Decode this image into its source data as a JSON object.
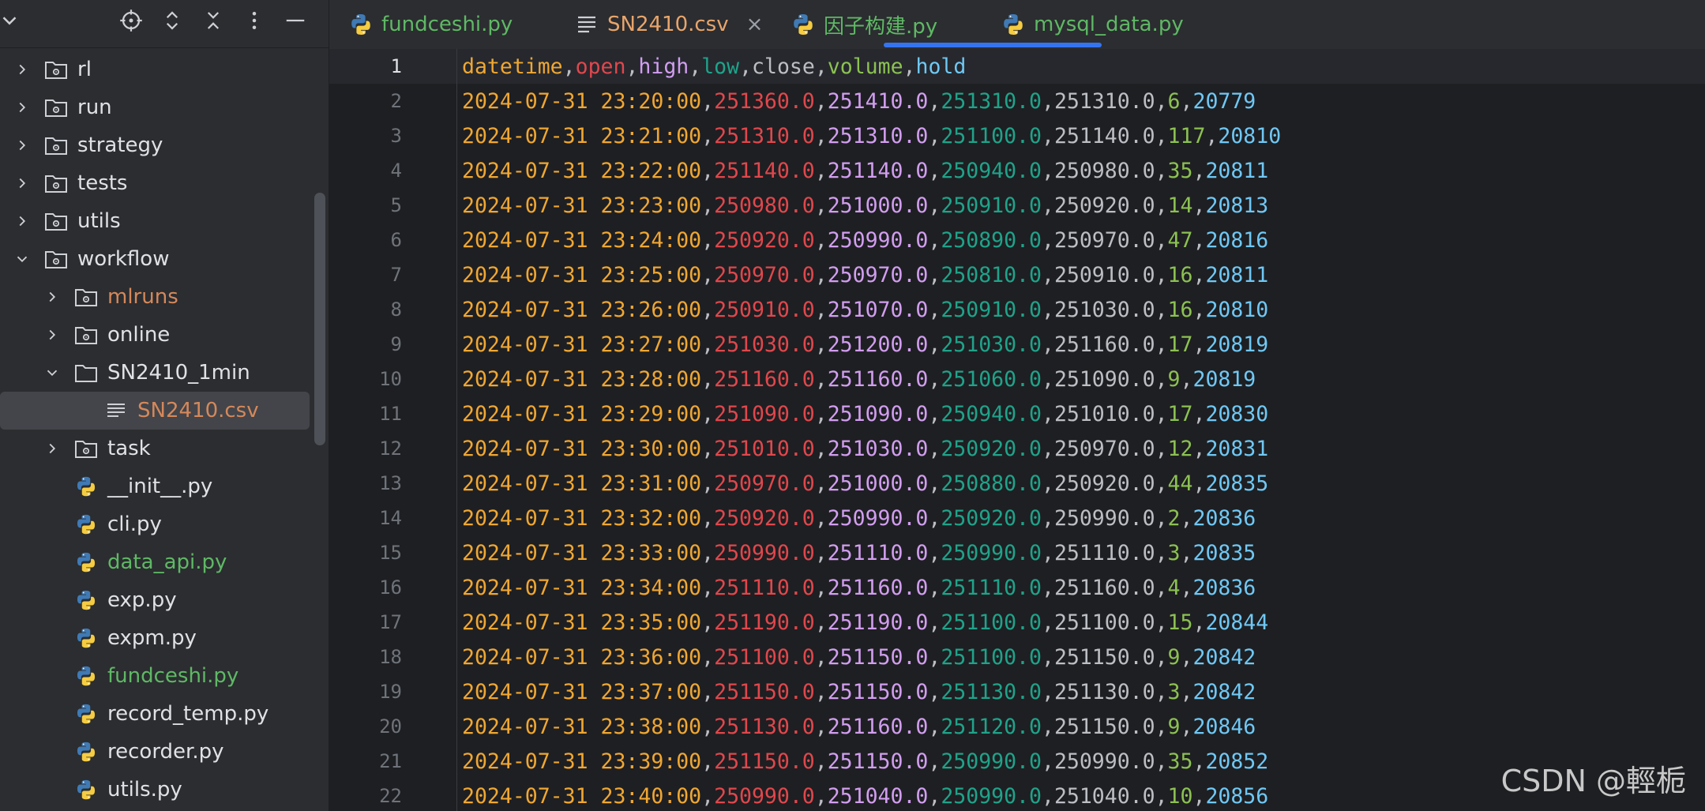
{
  "sidebar": {
    "toolbar": [
      "locate-icon",
      "expand-all-icon",
      "collapse-all-icon",
      "more-options-icon",
      "hide-icon"
    ],
    "items": [
      {
        "label": "rl",
        "type": "folder",
        "indent": 0,
        "expanded": false
      },
      {
        "label": "run",
        "type": "folder",
        "indent": 0,
        "expanded": false
      },
      {
        "label": "strategy",
        "type": "folder",
        "indent": 0,
        "expanded": false
      },
      {
        "label": "tests",
        "type": "folder",
        "indent": 0,
        "expanded": false
      },
      {
        "label": "utils",
        "type": "folder",
        "indent": 0,
        "expanded": false
      },
      {
        "label": "workflow",
        "type": "folder",
        "indent": 0,
        "expanded": true
      },
      {
        "label": "mlruns",
        "type": "folder",
        "indent": 1,
        "expanded": false,
        "color": "orange"
      },
      {
        "label": "online",
        "type": "folder",
        "indent": 1,
        "expanded": false
      },
      {
        "label": "SN2410_1min",
        "type": "plainfolder",
        "indent": 1,
        "expanded": true
      },
      {
        "label": "SN2410.csv",
        "type": "text",
        "indent": 2,
        "selected": true,
        "color": "orange"
      },
      {
        "label": "task",
        "type": "folder",
        "indent": 1,
        "expanded": false
      },
      {
        "label": "__init__.py",
        "type": "python",
        "indent": 1
      },
      {
        "label": "cli.py",
        "type": "python",
        "indent": 1
      },
      {
        "label": "data_api.py",
        "type": "python",
        "indent": 1,
        "color": "green"
      },
      {
        "label": "exp.py",
        "type": "python",
        "indent": 1
      },
      {
        "label": "expm.py",
        "type": "python",
        "indent": 1
      },
      {
        "label": "fundceshi.py",
        "type": "python",
        "indent": 1,
        "color": "green"
      },
      {
        "label": "record_temp.py",
        "type": "python",
        "indent": 1
      },
      {
        "label": "recorder.py",
        "type": "python",
        "indent": 1
      },
      {
        "label": "utils.py",
        "type": "python",
        "indent": 1
      }
    ]
  },
  "tabs": [
    {
      "label": "fundceshi.py",
      "icon": "python-icon",
      "color": "green"
    },
    {
      "label": "SN2410.csv",
      "icon": "text-file-icon",
      "color": "orange",
      "active": true,
      "close": "×"
    },
    {
      "label": "因子构建.py",
      "icon": "python-icon",
      "color": "green"
    },
    {
      "label": "mysql_data.py",
      "icon": "python-icon",
      "color": "green"
    }
  ],
  "editor": {
    "header": [
      "datetime",
      "open",
      "high",
      "low",
      "close",
      "volume",
      "hold"
    ],
    "start_line": 1,
    "rows": [
      [
        "2024-07-31 23:20:00",
        "251360.0",
        "251410.0",
        "251310.0",
        "251310.0",
        "6",
        "20779"
      ],
      [
        "2024-07-31 23:21:00",
        "251310.0",
        "251310.0",
        "251100.0",
        "251140.0",
        "117",
        "20810"
      ],
      [
        "2024-07-31 23:22:00",
        "251140.0",
        "251140.0",
        "250940.0",
        "250980.0",
        "35",
        "20811"
      ],
      [
        "2024-07-31 23:23:00",
        "250980.0",
        "251000.0",
        "250910.0",
        "250920.0",
        "14",
        "20813"
      ],
      [
        "2024-07-31 23:24:00",
        "250920.0",
        "250990.0",
        "250890.0",
        "250970.0",
        "47",
        "20816"
      ],
      [
        "2024-07-31 23:25:00",
        "250970.0",
        "250970.0",
        "250810.0",
        "250910.0",
        "16",
        "20811"
      ],
      [
        "2024-07-31 23:26:00",
        "250910.0",
        "251070.0",
        "250910.0",
        "251030.0",
        "16",
        "20810"
      ],
      [
        "2024-07-31 23:27:00",
        "251030.0",
        "251200.0",
        "251030.0",
        "251160.0",
        "17",
        "20819"
      ],
      [
        "2024-07-31 23:28:00",
        "251160.0",
        "251160.0",
        "251060.0",
        "251090.0",
        "9",
        "20819"
      ],
      [
        "2024-07-31 23:29:00",
        "251090.0",
        "251090.0",
        "250940.0",
        "251010.0",
        "17",
        "20830"
      ],
      [
        "2024-07-31 23:30:00",
        "251010.0",
        "251030.0",
        "250920.0",
        "250970.0",
        "12",
        "20831"
      ],
      [
        "2024-07-31 23:31:00",
        "250970.0",
        "251000.0",
        "250880.0",
        "250920.0",
        "44",
        "20835"
      ],
      [
        "2024-07-31 23:32:00",
        "250920.0",
        "250990.0",
        "250920.0",
        "250990.0",
        "2",
        "20836"
      ],
      [
        "2024-07-31 23:33:00",
        "250990.0",
        "251110.0",
        "250990.0",
        "251110.0",
        "3",
        "20835"
      ],
      [
        "2024-07-31 23:34:00",
        "251110.0",
        "251160.0",
        "251110.0",
        "251160.0",
        "4",
        "20836"
      ],
      [
        "2024-07-31 23:35:00",
        "251190.0",
        "251190.0",
        "251100.0",
        "251100.0",
        "15",
        "20844"
      ],
      [
        "2024-07-31 23:36:00",
        "251100.0",
        "251150.0",
        "251100.0",
        "251150.0",
        "9",
        "20842"
      ],
      [
        "2024-07-31 23:37:00",
        "251150.0",
        "251150.0",
        "251130.0",
        "251130.0",
        "3",
        "20842"
      ],
      [
        "2024-07-31 23:38:00",
        "251130.0",
        "251160.0",
        "251120.0",
        "251150.0",
        "9",
        "20846"
      ],
      [
        "2024-07-31 23:39:00",
        "251150.0",
        "251150.0",
        "250990.0",
        "250990.0",
        "35",
        "20852"
      ],
      [
        "2024-07-31 23:40:00",
        "250990.0",
        "251040.0",
        "250990.0",
        "251040.0",
        "10",
        "20856"
      ]
    ],
    "column_colors": [
      "#f0a732",
      "#e0474c",
      "#d29ef0",
      "#1fa38a",
      "#bcbec4",
      "#8cc152",
      "#6fc8f5"
    ]
  },
  "watermark": "CSDN @輕栀",
  "colors": {
    "accent": "#3574f0",
    "background": "#1e1f22",
    "panel": "#2b2d30"
  }
}
